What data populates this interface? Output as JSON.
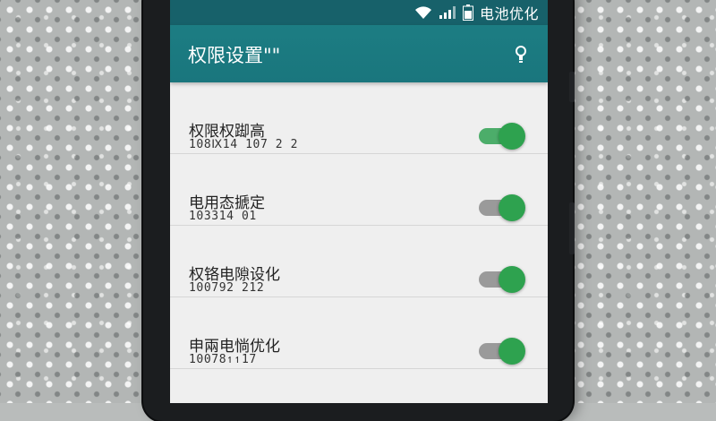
{
  "status_bar": {
    "label": "电池优化",
    "icons": [
      "wifi-icon",
      "signal-icon",
      "battery-icon"
    ]
  },
  "app_bar": {
    "title": "权限设置\"\"",
    "icon": "lightbulb-icon"
  },
  "settings": [
    {
      "title": "权限权踋高",
      "subtitle": "108Ⅸ14 107 2 2",
      "enabled": true,
      "track_color": "#4cad6a"
    },
    {
      "title": "电用态搋定",
      "subtitle": "103314 01",
      "enabled": true,
      "track_color": "#9a9a9a"
    },
    {
      "title": "权铬电隙设化",
      "subtitle": "100792 212",
      "enabled": true,
      "track_color": "#9a9a9a"
    },
    {
      "title": "申兩电惝优化",
      "subtitle": "10078↿↿17",
      "enabled": true,
      "track_color": "#9a9a9a"
    }
  ],
  "colors": {
    "status_bar": "#17616a",
    "app_bar": "#1c7d83",
    "toggle_on": "#2ea24f"
  }
}
